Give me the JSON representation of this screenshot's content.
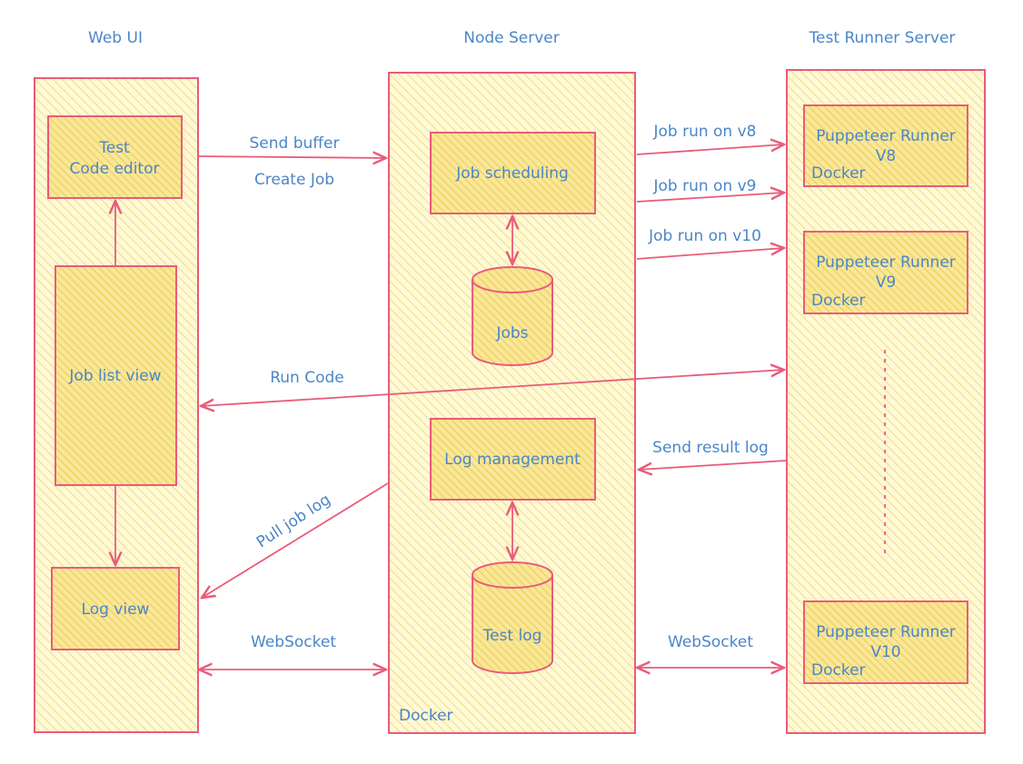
{
  "columns": {
    "web_ui": "Web UI",
    "node_server": "Node Server",
    "test_runner_server": "Test Runner Server"
  },
  "web_ui": {
    "code_editor": [
      "Test",
      "Code editor"
    ],
    "job_list_view": "Job list view",
    "log_view": "Log view"
  },
  "node_server": {
    "job_scheduling": "Job scheduling",
    "jobs_db": "Jobs",
    "log_management": "Log management",
    "test_log_db": "Test log",
    "docker": "Docker"
  },
  "runners": [
    {
      "name": "Puppeteer Runner",
      "version": "V8",
      "docker": "Docker"
    },
    {
      "name": "Puppeteer Runner",
      "version": "V9",
      "docker": "Docker"
    },
    {
      "name": "Puppeteer Runner",
      "version": "V10",
      "docker": "Docker"
    }
  ],
  "edges": {
    "send_buffer": "Send buffer",
    "create_job": "Create Job",
    "job_run_v8": "Job run on v8",
    "job_run_v9": "Job run on v9",
    "job_run_v10": "Job run on v10",
    "run_code": "Run Code",
    "send_result_log": "Send result log",
    "pull_job_log": "Pull job log",
    "websocket_left": "WebSocket",
    "websocket_right": "WebSocket"
  },
  "colors": {
    "stroke": "#ea5b7a",
    "text": "#4a86c8",
    "fill_light": "#fdf6c9",
    "fill_dark": "#f8e48a"
  }
}
